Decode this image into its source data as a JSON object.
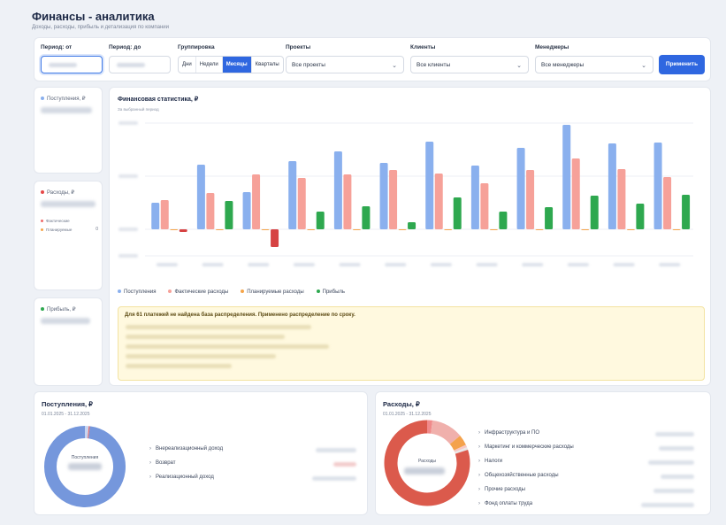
{
  "header": {
    "title": "Финансы - аналитика",
    "subtitle": "Доходы, расходы, прибыль и детализация по компании"
  },
  "filters": {
    "period_from_label": "Период: от",
    "period_to_label": "Период: до",
    "grouping_label": "Группировка",
    "grouping_options": [
      "Дни",
      "Недели",
      "Месяцы",
      "Кварталы"
    ],
    "grouping_selected": "Месяцы",
    "projects_label": "Проекты",
    "projects_value": "Все проекты",
    "clients_label": "Клиенты",
    "clients_value": "Все клиенты",
    "managers_label": "Менеджеры",
    "managers_value": "Все менеджеры",
    "apply_label": "Применить"
  },
  "stats": {
    "income_label": "Поступления, ₽",
    "expense_label": "Расходы, ₽",
    "expense_fact_label": "Фактические",
    "expense_plan_label": "Планируемые",
    "expense_plan_value": "0",
    "profit_label": "Прибыль, ₽"
  },
  "chart": {
    "title": "Финансовая статистика, ₽",
    "subtitle": "За выбранный период",
    "notice": "Для 61 платежей не найдена база распределения. Применено распределение по сроку.",
    "legend": [
      "Поступления",
      "Фактические расходы",
      "Планируемые расходы",
      "Прибыль"
    ]
  },
  "chart_data": {
    "type": "bar",
    "categories": [
      "",
      "",
      "",
      "",
      "",
      "",
      "",
      "",
      "",
      "",
      "",
      ""
    ],
    "series": [
      {
        "name": "Поступления",
        "values": [
          30,
          73,
          42,
          77,
          88,
          75,
          99,
          72,
          92,
          118,
          97,
          98
        ]
      },
      {
        "name": "Фактические расходы",
        "values": [
          33,
          41,
          62,
          58,
          62,
          67,
          63,
          52,
          67,
          80,
          68,
          59
        ]
      },
      {
        "name": "Планируемые расходы",
        "values": [
          0,
          0,
          0,
          0,
          0,
          0,
          0,
          0,
          0,
          0,
          0,
          0
        ]
      },
      {
        "name": "Прибыль",
        "values": [
          -3,
          32,
          -20,
          20,
          26,
          8,
          36,
          20,
          25,
          38,
          29,
          39
        ]
      }
    ],
    "colors": [
      "#8ab0ee",
      "#f6a199",
      "#f5a54a",
      "#2ea84f"
    ],
    "negative_profit_color": "#d64242",
    "ylim": [
      -30,
      120
    ],
    "grid": true,
    "legend_position": "bottom-left"
  },
  "income_panel": {
    "title": "Поступления, ₽",
    "date_range": "01.01.2025 - 31.12.2025",
    "donut_center_label": "Поступления",
    "items": [
      "Внереализационный доход",
      "Возврат",
      "Реализационный доход"
    ],
    "shares": [
      0.015,
      0.005,
      0.98
    ],
    "colors": [
      "#c6d4f1",
      "#e66a6a",
      "#7597dc"
    ]
  },
  "expense_panel": {
    "title": "Расходы, ₽",
    "date_range": "01.01.2025 - 31.12.2025",
    "donut_center_label": "Расходы",
    "items": [
      "Инфраструктура и ПО",
      "Маркетинг и коммерческие расходы",
      "Налоги",
      "Общехозяйственные расходы",
      "Прочие расходы",
      "Фонд оплаты труда"
    ],
    "shares": [
      0.02,
      0.12,
      0.04,
      0.01,
      0.01,
      0.8
    ],
    "colors": [
      "#f08a8a",
      "#f0b0ac",
      "#f4a24c",
      "#f7c8c4",
      "#e9e9e9",
      "#db5a4c"
    ]
  },
  "colors": {
    "accent": "#2f67e0",
    "income": "#8ab0ee",
    "expense": "#f06b6b",
    "plan": "#f5a54a",
    "profit": "#2ea84f"
  }
}
